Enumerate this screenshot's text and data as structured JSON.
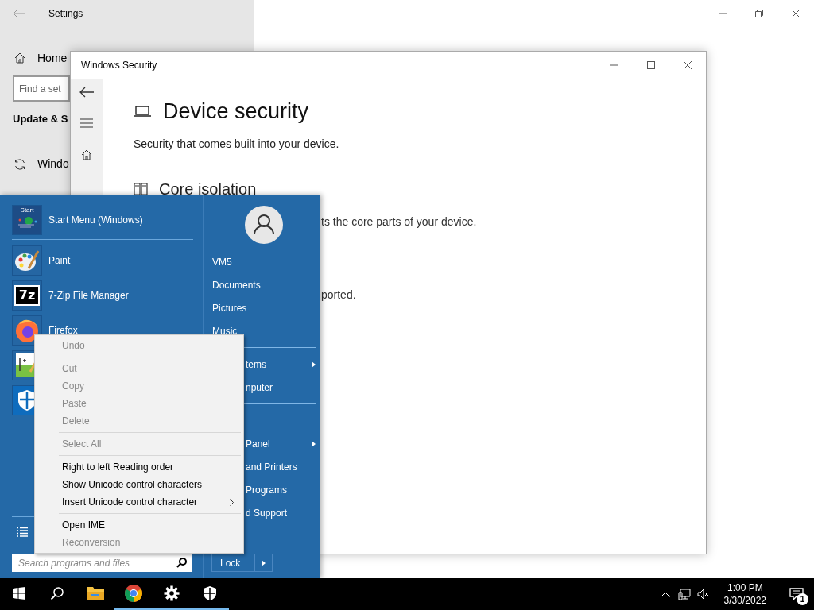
{
  "settings_window": {
    "title": "Settings",
    "home": "Home",
    "search": {
      "placeholder": "Find a set"
    },
    "section": "Update & S",
    "items": [
      {
        "label": "Windo"
      }
    ]
  },
  "security_window": {
    "title": "Windows Security",
    "heading": "Device security",
    "subtitle": "Security that comes built into your device.",
    "section_title": "Core isolation",
    "section_text": "ts the core parts of your device.",
    "status_text": "ported."
  },
  "start_menu": {
    "pinned": [
      {
        "kind": "startmenu",
        "label": "Start Menu (Windows)",
        "icon_text": "Start"
      },
      {
        "kind": "paint",
        "label": "Paint"
      },
      {
        "kind": "sevenzip",
        "label": "7-Zip File Manager",
        "icon_text": "7z"
      },
      {
        "kind": "firefox",
        "label": "Firefox"
      },
      {
        "kind": "notepad"
      },
      {
        "kind": "shield"
      }
    ],
    "user": {
      "kind": "avatar"
    },
    "places": [
      [
        {
          "label": "VM5",
          "kind": "full",
          "submenu": false
        },
        {
          "label": "Documents",
          "kind": "full",
          "submenu": false
        },
        {
          "label": "Pictures",
          "kind": "full",
          "submenu": false
        },
        {
          "label": "Music",
          "kind": "full",
          "submenu": false
        }
      ],
      [
        {
          "label": "tems",
          "kind": "partial",
          "submenu": true
        },
        {
          "label": "nputer",
          "kind": "partial",
          "submenu": false
        }
      ],
      [
        {
          "label": "Panel",
          "kind": "partial",
          "submenu": true
        },
        {
          "label": "and Printers",
          "kind": "partial",
          "submenu": false
        },
        {
          "label": "Programs",
          "kind": "partial",
          "submenu": false
        },
        {
          "label": "d Support",
          "kind": "partial",
          "submenu": false
        }
      ]
    ],
    "search": {
      "placeholder": "Search programs and files"
    },
    "power": {
      "label": "Lock"
    }
  },
  "context_menu": [
    {
      "kind": "item",
      "label": "Undo",
      "disabled": true,
      "submenu": false
    },
    {
      "kind": "separator"
    },
    {
      "kind": "item",
      "label": "Cut",
      "disabled": true,
      "submenu": false
    },
    {
      "kind": "item",
      "label": "Copy",
      "disabled": true,
      "submenu": false
    },
    {
      "kind": "item",
      "label": "Paste",
      "disabled": true,
      "submenu": false
    },
    {
      "kind": "item",
      "label": "Delete",
      "disabled": true,
      "submenu": false
    },
    {
      "kind": "separator"
    },
    {
      "kind": "item",
      "label": "Select All",
      "disabled": true,
      "submenu": false
    },
    {
      "kind": "separator"
    },
    {
      "kind": "item",
      "label": "Right to left Reading order",
      "disabled": false,
      "submenu": false
    },
    {
      "kind": "item",
      "label": "Show Unicode control characters",
      "disabled": false,
      "submenu": false
    },
    {
      "kind": "item",
      "label": "Insert Unicode control character",
      "disabled": false,
      "submenu": true
    },
    {
      "kind": "separator"
    },
    {
      "kind": "item",
      "label": "Open IME",
      "disabled": false,
      "submenu": false
    },
    {
      "kind": "item",
      "label": "Reconversion",
      "disabled": true,
      "submenu": false
    }
  ],
  "taskbar": {
    "items": [
      {
        "kind": "start",
        "running": false
      },
      {
        "kind": "search",
        "running": false
      },
      {
        "kind": "explorer",
        "running": false
      },
      {
        "kind": "chrome",
        "running": true
      },
      {
        "kind": "settings",
        "running": true
      },
      {
        "kind": "shield",
        "running": true
      }
    ],
    "time": "1:00 PM",
    "date": "3/30/2022",
    "notifications": "1"
  }
}
